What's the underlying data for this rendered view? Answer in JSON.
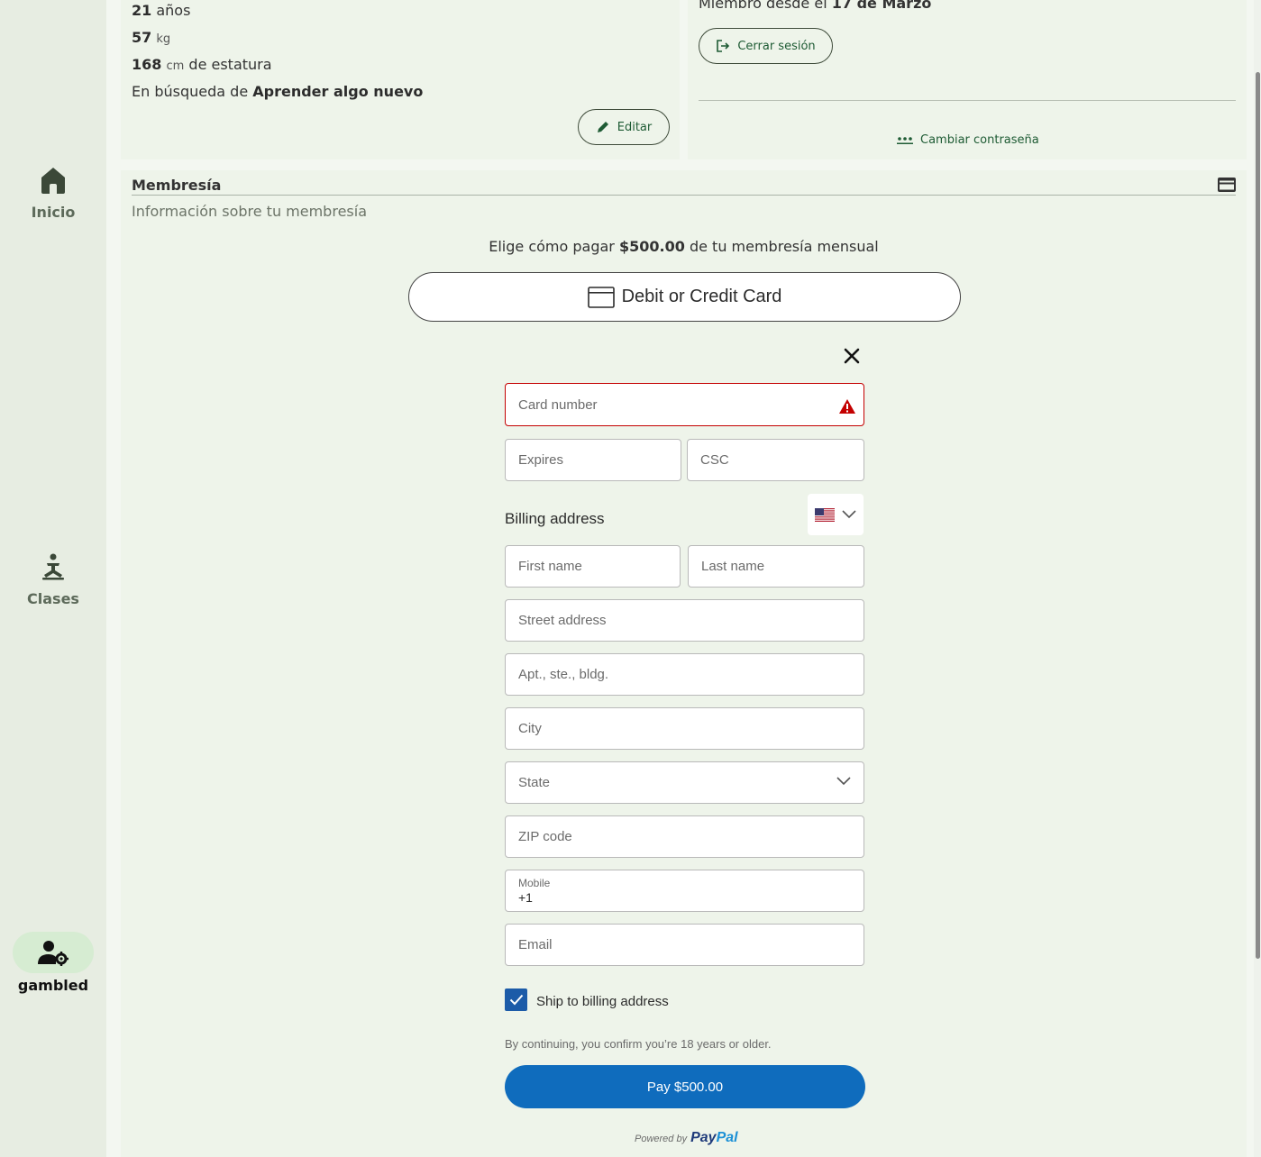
{
  "sidebar": {
    "home_label": "Inicio",
    "classes_label": "Clases",
    "user_label": "gambled"
  },
  "profile": {
    "age_value": "21",
    "age_unit": "años",
    "weight_value": "57",
    "weight_unit": "kg",
    "height_value": "168",
    "height_unit": "cm",
    "height_suffix": "de estatura",
    "goal_prefix": "En búsqueda de",
    "goal_value": "Aprender algo nuevo",
    "edit_label": "Editar"
  },
  "account": {
    "member_since_prefix": "Miembro desde el",
    "member_since_date": "17 de Marzo",
    "logout_label": "Cerrar sesión",
    "change_password_label": "Cambiar contraseña"
  },
  "membership": {
    "title": "Membresía",
    "subtitle": "Información sobre tu membresía",
    "choose_prefix": "Elige cómo pagar",
    "choose_amount": "$500.00",
    "choose_suffix": "de tu membresía mensual",
    "card_button_label": "Debit or Credit Card"
  },
  "paypal_form": {
    "card_number_placeholder": "Card number",
    "expires_placeholder": "Expires",
    "csc_placeholder": "CSC",
    "billing_heading": "Billing address",
    "country_flag": "us-flag",
    "first_name_placeholder": "First name",
    "last_name_placeholder": "Last name",
    "street_placeholder": "Street address",
    "apt_placeholder": "Apt., ste., bldg.",
    "city_placeholder": "City",
    "state_placeholder": "State",
    "zip_placeholder": "ZIP code",
    "mobile_label": "Mobile",
    "mobile_value": "+1",
    "email_placeholder": "Email",
    "ship_to_billing_checked": true,
    "ship_to_billing_label": "Ship to billing address",
    "age_confirm_text": "By continuing, you confirm you’re 18 years or older.",
    "pay_button_label": "Pay $500.00",
    "powered_by_text": "Powered by",
    "brand_pay": "Pay",
    "brand_pal": "Pal"
  },
  "colors": {
    "accent_green": "#1e5b34",
    "error_red": "#c40000",
    "pay_blue": "#0f6cbd"
  }
}
